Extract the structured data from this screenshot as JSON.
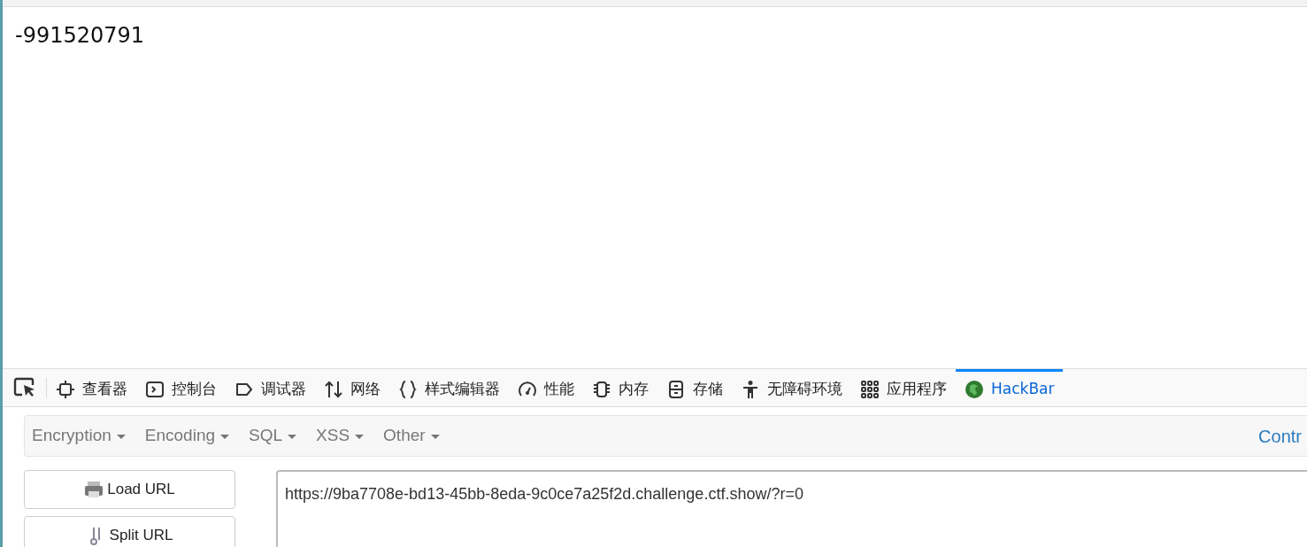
{
  "page": {
    "output": "-991520791"
  },
  "devtools_tabs": [
    {
      "kind": "inspector",
      "label": "查看器",
      "selected": false
    },
    {
      "kind": "console",
      "label": "控制台",
      "selected": false
    },
    {
      "kind": "debugger",
      "label": "调试器",
      "selected": false
    },
    {
      "kind": "network",
      "label": "网络",
      "selected": false
    },
    {
      "kind": "style",
      "label": "样式编辑器",
      "selected": false
    },
    {
      "kind": "performance",
      "label": "性能",
      "selected": false
    },
    {
      "kind": "memory",
      "label": "内存",
      "selected": false
    },
    {
      "kind": "storage",
      "label": "存储",
      "selected": false
    },
    {
      "kind": "accessibility",
      "label": "无障碍环境",
      "selected": false
    },
    {
      "kind": "apps",
      "label": "应用程序",
      "selected": false
    },
    {
      "kind": "hackbar",
      "label": "HackBar",
      "selected": true
    }
  ],
  "hackbar": {
    "menus": [
      "Encryption",
      "Encoding",
      "SQL",
      "XSS",
      "Other"
    ],
    "right_link": "Contr",
    "buttons": [
      {
        "kind": "load",
        "label": "Load URL"
      },
      {
        "kind": "split",
        "label": "Split URL"
      }
    ],
    "url": "https://9ba7708e-bd13-45bb-8eda-9c0ce7a25f2d.challenge.ctf.show/?r=0"
  }
}
